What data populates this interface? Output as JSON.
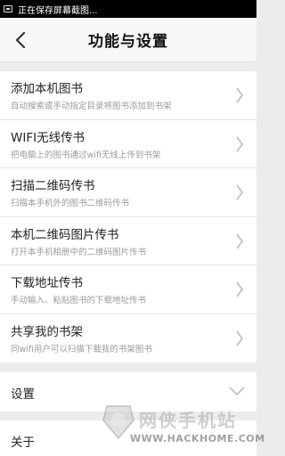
{
  "status_bar": {
    "text": "正在保存屏幕截图..."
  },
  "header": {
    "title": "功能与设置",
    "back_icon": "chevron-left-icon"
  },
  "import_options": [
    {
      "title": "添加本机图书",
      "subtitle": "自动搜索或手动指定目录将图书添加到书架"
    },
    {
      "title": "WIFI无线传书",
      "subtitle": "把电脑上的图书通过wifi无线上传到书架"
    },
    {
      "title": "扫描二维码传书",
      "subtitle": "扫描本手机外的图书二维码传书"
    },
    {
      "title": "本机二维码图片传书",
      "subtitle": "打开本手机相册中的二维码图片传书"
    },
    {
      "title": "下载地址传书",
      "subtitle": "手动输入、粘贴图书的下载地址传书"
    },
    {
      "title": "共享我的书架",
      "subtitle": "同wifi用户可以扫描下载我的书架图书"
    }
  ],
  "settings": {
    "label": "设置"
  },
  "about": {
    "label": "关于"
  },
  "watermark": {
    "name": "网侠手机站",
    "url": "WWW.HACKHOME.COM"
  },
  "colors": {
    "background": "#ececec",
    "header": "#f7f7f7",
    "text": "#222222",
    "subtext": "#9a9a9a"
  }
}
